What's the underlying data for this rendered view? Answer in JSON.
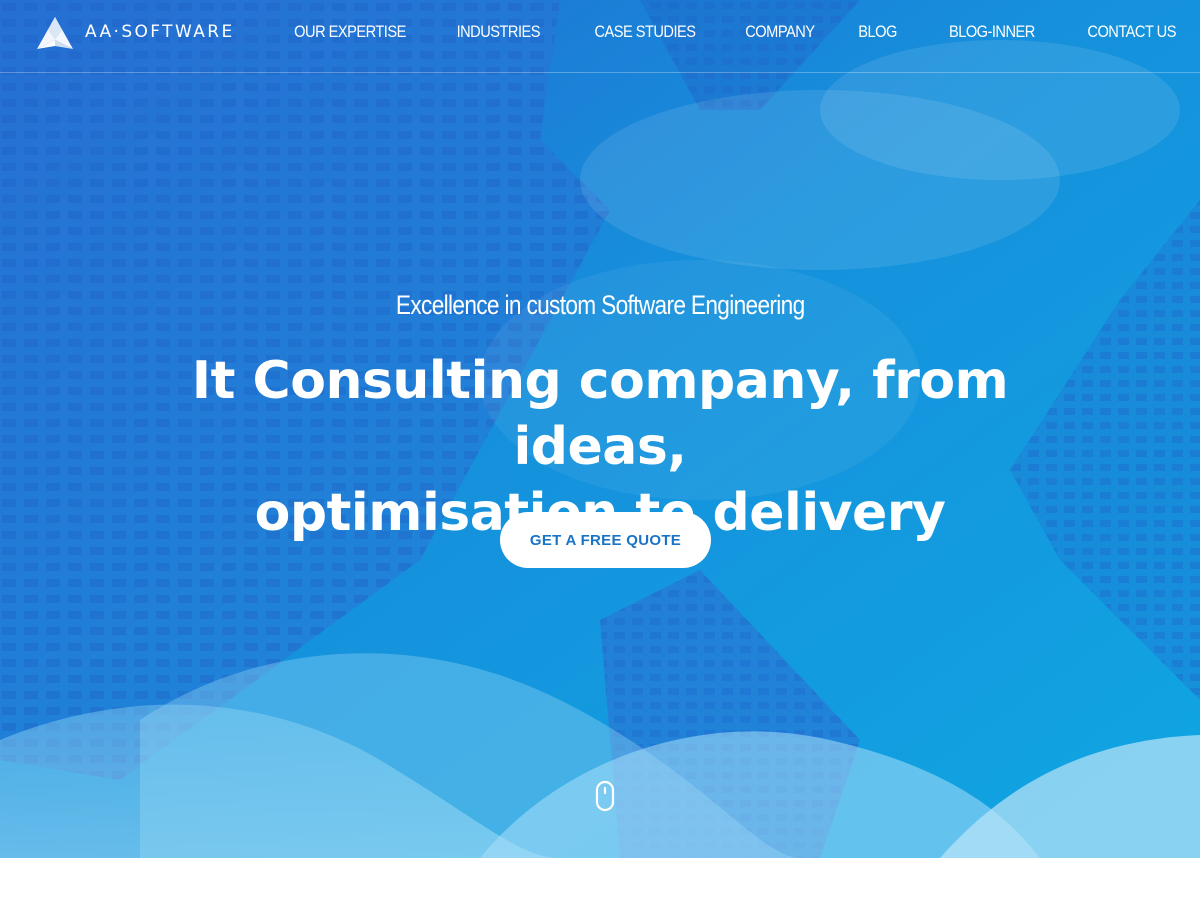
{
  "brand": {
    "logo_text": "AA·SOFTWARE",
    "logo_icon": "aa-triangle-logo-icon"
  },
  "nav": {
    "items": [
      {
        "label": "OUR EXPERTISE"
      },
      {
        "label": "INDUSTRIES"
      },
      {
        "label": "CASE STUDIES"
      },
      {
        "label": "COMPANY"
      },
      {
        "label": "BLOG"
      },
      {
        "label": "BLOG-INNER"
      },
      {
        "label": "CONTACT US"
      }
    ]
  },
  "hero": {
    "tagline": "Excellence in custom Software Engineering",
    "headline_line1": "It Consulting company, from ideas,",
    "headline_line2": "optimisation to delivery",
    "cta_label": "GET A FREE QUOTE",
    "scroll_icon": "mouse-scroll-icon"
  },
  "colors": {
    "hero_blue": "#1a86dc",
    "cta_text": "#1a74c6",
    "wave_light": "#8fd3f2",
    "white": "#ffffff"
  }
}
